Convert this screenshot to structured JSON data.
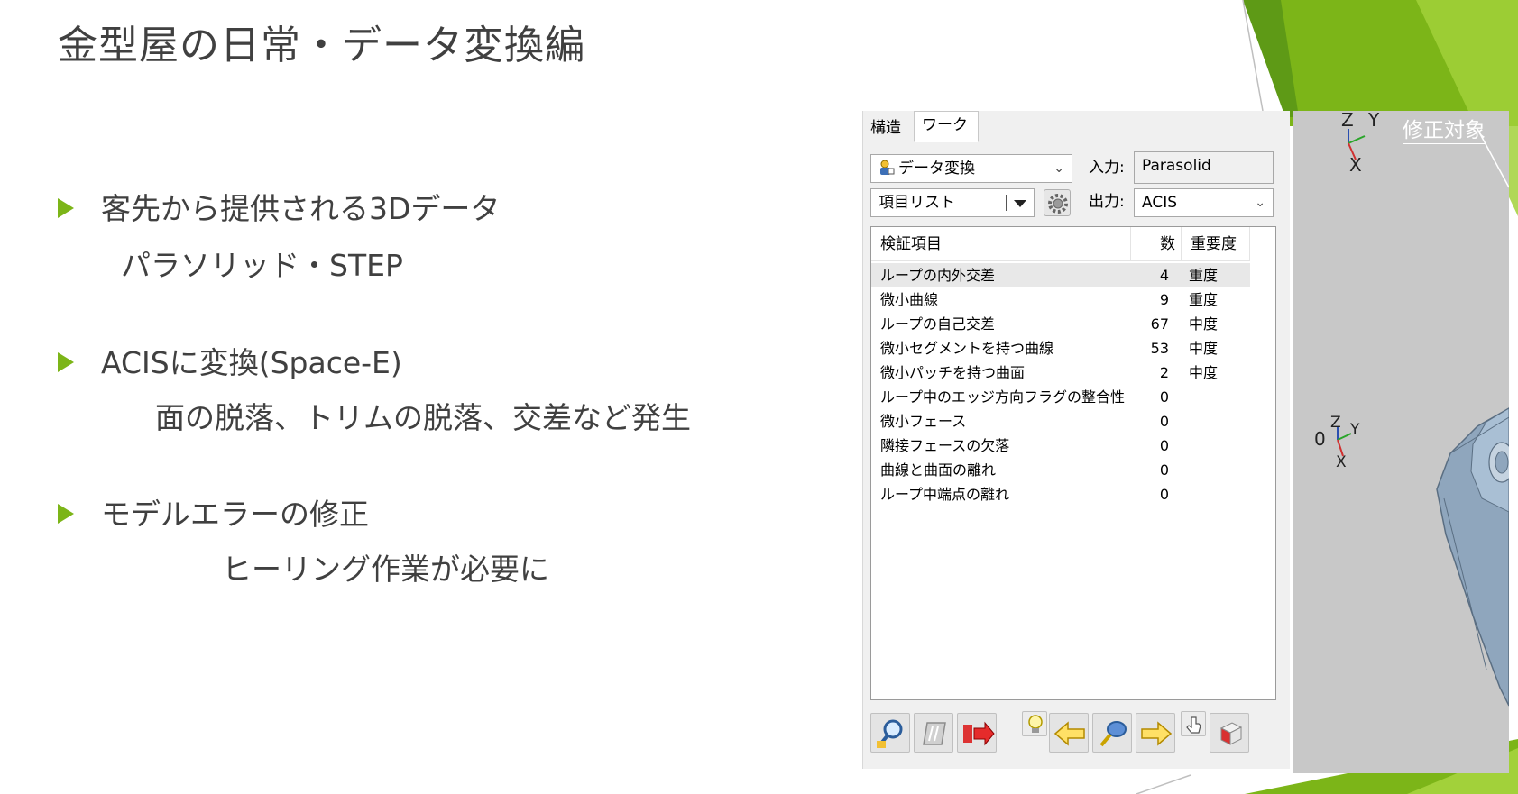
{
  "slide": {
    "title": "金型屋の日常・データ変換編",
    "bullets": [
      {
        "text": "客先から提供される3Dデータ",
        "sub": "パラソリッド・STEP"
      },
      {
        "text": "ACISに変換(Space-E)",
        "sub": "面の脱落、トリムの脱落、交差など発生"
      },
      {
        "text": "モデルエラーの修正",
        "sub": "ヒーリング作業が必要に"
      }
    ],
    "accent_color": "#7cb518"
  },
  "dialog": {
    "tabs": [
      "構造",
      "ワーク"
    ],
    "active_tab": "ワーク",
    "mode_select": {
      "value": "データ変換",
      "icon": "person-convert-icon"
    },
    "input_label": "入力:",
    "input_value": "Parasolid",
    "output_label": "出力:",
    "output_value": "ACIS",
    "list_select": "項目リスト",
    "table": {
      "headers": [
        "検証項目",
        "数",
        "重要度"
      ],
      "rows": [
        {
          "item": "ループの内外交差",
          "count": "4",
          "severity": "重度"
        },
        {
          "item": "微小曲線",
          "count": "9",
          "severity": "重度"
        },
        {
          "item": "ループの自己交差",
          "count": "67",
          "severity": "中度"
        },
        {
          "item": "微小セグメントを持つ曲線",
          "count": "53",
          "severity": "中度"
        },
        {
          "item": "微小パッチを持つ曲面",
          "count": "2",
          "severity": "中度"
        },
        {
          "item": "ループ中のエッジ方向フラグの整合性",
          "count": "0",
          "severity": ""
        },
        {
          "item": "微小フェース",
          "count": "0",
          "severity": ""
        },
        {
          "item": "隣接フェースの欠落",
          "count": "0",
          "severity": ""
        },
        {
          "item": "曲線と曲面の離れ",
          "count": "0",
          "severity": ""
        },
        {
          "item": "ループ中端点の離れ",
          "count": "0",
          "severity": ""
        }
      ]
    },
    "toolbar": [
      "inspect-icon",
      "edit-icon",
      "convert-icon",
      "bulb-icon",
      "prev-arrow-icon",
      "zoom-icon",
      "next-arrow-icon",
      "pointer-icon",
      "box-icon"
    ]
  },
  "viewport": {
    "label": "修正対象",
    "axes_top": {
      "z": "Z",
      "y": "Y",
      "x": "X"
    },
    "axes_model": {
      "origin": "0",
      "z": "Z",
      "y": "Y",
      "x": "X"
    }
  }
}
